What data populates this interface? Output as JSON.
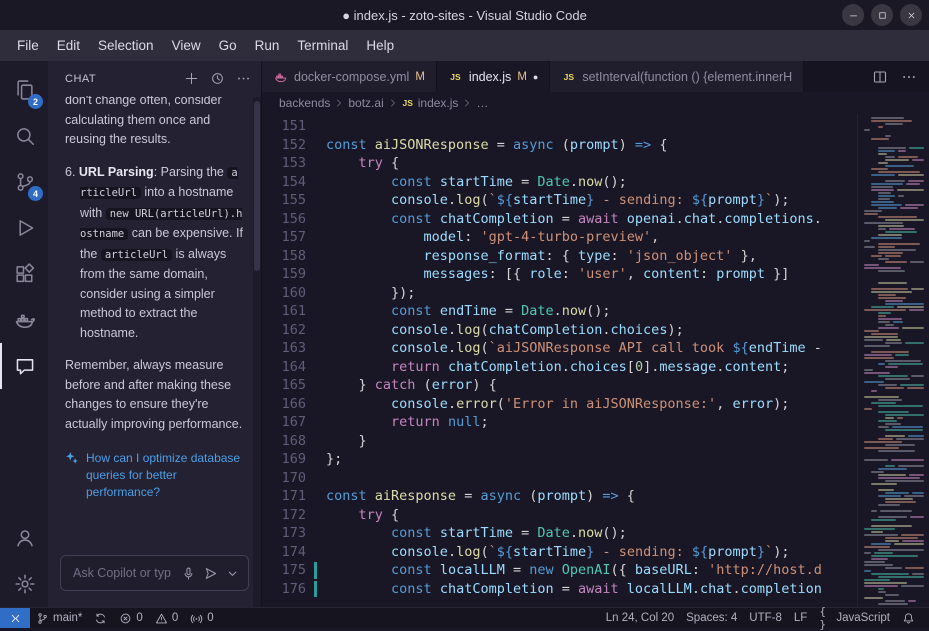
{
  "colors": {
    "accent_blue": "#2f6dc6",
    "modified_badge": "#e2c08d",
    "suggestion_blue": "#4d9fe6"
  },
  "titlebar": {
    "title": "● index.js - zoto-sites - Visual Studio Code",
    "controls": [
      "minimize",
      "maximize",
      "close"
    ]
  },
  "menubar": {
    "items": [
      "File",
      "Edit",
      "Selection",
      "View",
      "Go",
      "Run",
      "Terminal",
      "Help"
    ]
  },
  "activity_bar": {
    "top": [
      {
        "name": "explorer",
        "badge": "2"
      },
      {
        "name": "search"
      },
      {
        "name": "source-control",
        "badge": "4"
      },
      {
        "name": "run-debug"
      },
      {
        "name": "extensions"
      },
      {
        "name": "docker"
      },
      {
        "name": "chat",
        "active": true
      }
    ],
    "bottom": [
      {
        "name": "accounts"
      },
      {
        "name": "settings"
      }
    ]
  },
  "chat": {
    "title": "CHAT",
    "toolbar": [
      {
        "name": "new-chat",
        "icon": "add"
      },
      {
        "name": "history",
        "icon": "history"
      },
      {
        "name": "more",
        "icon": "more"
      }
    ],
    "paragraphs": [
      {
        "clip": true,
        "segs": [
          {
            "t": "p",
            "s": "don't change often, consider calculating them once and reusing the results."
          }
        ]
      },
      {
        "numbered": true,
        "segs": [
          {
            "t": "p",
            "s": "6. "
          },
          {
            "t": "b",
            "s": "URL Parsing"
          },
          {
            "t": "p",
            "s": ": Parsing the "
          },
          {
            "t": "c",
            "s": "articleUrl"
          },
          {
            "t": "p",
            "s": " into a hostname with "
          },
          {
            "t": "c",
            "s": "new URL(articleUrl).hostname"
          },
          {
            "t": "p",
            "s": " can be expensive. If the "
          },
          {
            "t": "c",
            "s": "articleUrl"
          },
          {
            "t": "p",
            "s": " is always from the same domain, consider using a simpler method to extract the hostname."
          }
        ]
      },
      {
        "segs": [
          {
            "t": "p",
            "s": "Remember, always measure before and after making these changes to ensure they're actually improving performance."
          }
        ]
      }
    ],
    "suggestion": {
      "icon": "sparkle",
      "text": "How can I optimize database queries for better performance?"
    },
    "input": {
      "placeholder": "Ask Copilot or typ",
      "icons": [
        {
          "name": "mic",
          "icon": "mic"
        },
        {
          "name": "send",
          "icon": "send"
        },
        {
          "name": "send-options",
          "icon": "chevron-down"
        }
      ]
    }
  },
  "editor": {
    "tabs": [
      {
        "name": "tab-docker-compose",
        "icon": "docker-file",
        "label": "docker-compose.yml",
        "badge": "M"
      },
      {
        "name": "tab-index-js",
        "icon": "js-file",
        "label": "index.js",
        "badge": "M",
        "dirty": true,
        "active": true
      },
      {
        "name": "tab-setinterval",
        "icon": "js-file",
        "label": "setInterval(function () {element.innerH"
      }
    ],
    "tab_actions": [
      {
        "name": "split-editor",
        "icon": "split-editor"
      },
      {
        "name": "more-actions",
        "icon": "more"
      }
    ],
    "breadcrumbs": [
      {
        "label": "backends"
      },
      {
        "label": "botz.ai"
      },
      {
        "label": "index.js",
        "icon": "js-file"
      },
      {
        "label": "…"
      }
    ],
    "code": {
      "lines": [
        {
          "n": 151,
          "t": []
        },
        {
          "n": 152,
          "t": [
            [
              "k",
              "const "
            ],
            [
              "f",
              "aiJSONResponse"
            ],
            [
              "p",
              " = "
            ],
            [
              "k",
              "async"
            ],
            [
              "p",
              " ("
            ],
            [
              "v",
              "prompt"
            ],
            [
              "p",
              ") "
            ],
            [
              "k",
              "=>"
            ],
            [
              "p",
              " {"
            ]
          ]
        },
        {
          "n": 153,
          "t": [
            [
              "p",
              "    "
            ],
            [
              "c",
              "try"
            ],
            [
              "p",
              " {"
            ]
          ]
        },
        {
          "n": 154,
          "t": [
            [
              "p",
              "        "
            ],
            [
              "k",
              "const "
            ],
            [
              "v",
              "startTime"
            ],
            [
              "p",
              " = "
            ],
            [
              "ty",
              "Date"
            ],
            [
              "p",
              "."
            ],
            [
              "f",
              "now"
            ],
            [
              "p",
              "();"
            ]
          ]
        },
        {
          "n": 155,
          "t": [
            [
              "p",
              "        "
            ],
            [
              "v",
              "console"
            ],
            [
              "p",
              "."
            ],
            [
              "f",
              "log"
            ],
            [
              "p",
              "("
            ],
            [
              "s",
              "`"
            ],
            [
              "k",
              "${"
            ],
            [
              "v",
              "startTime"
            ],
            [
              "k",
              "}"
            ],
            [
              "s",
              " - sending: "
            ],
            [
              "k",
              "${"
            ],
            [
              "v",
              "prompt"
            ],
            [
              "k",
              "}"
            ],
            [
              "s",
              "`"
            ],
            [
              "p",
              ");"
            ]
          ]
        },
        {
          "n": 156,
          "t": [
            [
              "p",
              "        "
            ],
            [
              "k",
              "const "
            ],
            [
              "v",
              "chatCompletion"
            ],
            [
              "p",
              " = "
            ],
            [
              "c",
              "await"
            ],
            [
              "p",
              " "
            ],
            [
              "v",
              "openai"
            ],
            [
              "p",
              "."
            ],
            [
              "v",
              "chat"
            ],
            [
              "p",
              "."
            ],
            [
              "v",
              "completions"
            ],
            [
              "p",
              "."
            ]
          ]
        },
        {
          "n": 157,
          "t": [
            [
              "p",
              "            "
            ],
            [
              "v",
              "model"
            ],
            [
              "p",
              ": "
            ],
            [
              "s",
              "'gpt-4-turbo-preview'"
            ],
            [
              "p",
              ","
            ]
          ]
        },
        {
          "n": 158,
          "t": [
            [
              "p",
              "            "
            ],
            [
              "v",
              "response_format"
            ],
            [
              "p",
              ": { "
            ],
            [
              "v",
              "type"
            ],
            [
              "p",
              ": "
            ],
            [
              "s",
              "'json_object'"
            ],
            [
              "p",
              " },"
            ]
          ]
        },
        {
          "n": 159,
          "t": [
            [
              "p",
              "            "
            ],
            [
              "v",
              "messages"
            ],
            [
              "p",
              ": [{ "
            ],
            [
              "v",
              "role"
            ],
            [
              "p",
              ": "
            ],
            [
              "s",
              "'user'"
            ],
            [
              "p",
              ", "
            ],
            [
              "v",
              "content"
            ],
            [
              "p",
              ": "
            ],
            [
              "v",
              "prompt"
            ],
            [
              "p",
              " }]"
            ]
          ]
        },
        {
          "n": 160,
          "t": [
            [
              "p",
              "        });"
            ]
          ]
        },
        {
          "n": 161,
          "t": [
            [
              "p",
              "        "
            ],
            [
              "k",
              "const "
            ],
            [
              "v",
              "endTime"
            ],
            [
              "p",
              " = "
            ],
            [
              "ty",
              "Date"
            ],
            [
              "p",
              "."
            ],
            [
              "f",
              "now"
            ],
            [
              "p",
              "();"
            ]
          ]
        },
        {
          "n": 162,
          "t": [
            [
              "p",
              "        "
            ],
            [
              "v",
              "console"
            ],
            [
              "p",
              "."
            ],
            [
              "f",
              "log"
            ],
            [
              "p",
              "("
            ],
            [
              "v",
              "chatCompletion"
            ],
            [
              "p",
              "."
            ],
            [
              "v",
              "choices"
            ],
            [
              "p",
              ");"
            ]
          ]
        },
        {
          "n": 163,
          "t": [
            [
              "p",
              "        "
            ],
            [
              "v",
              "console"
            ],
            [
              "p",
              "."
            ],
            [
              "f",
              "log"
            ],
            [
              "p",
              "("
            ],
            [
              "s",
              "`aiJSONResponse API call took "
            ],
            [
              "k",
              "${"
            ],
            [
              "v",
              "endTime"
            ],
            [
              "p",
              " -"
            ]
          ]
        },
        {
          "n": 164,
          "t": [
            [
              "p",
              "        "
            ],
            [
              "c",
              "return"
            ],
            [
              "p",
              " "
            ],
            [
              "v",
              "chatCompletion"
            ],
            [
              "p",
              "."
            ],
            [
              "v",
              "choices"
            ],
            [
              "p",
              "["
            ],
            [
              "num",
              "0"
            ],
            [
              "p",
              "]."
            ],
            [
              "v",
              "message"
            ],
            [
              "p",
              "."
            ],
            [
              "v",
              "content"
            ],
            [
              "p",
              ";"
            ]
          ]
        },
        {
          "n": 165,
          "t": [
            [
              "p",
              "    } "
            ],
            [
              "c",
              "catch"
            ],
            [
              "p",
              " ("
            ],
            [
              "v",
              "error"
            ],
            [
              "p",
              ") {"
            ]
          ]
        },
        {
          "n": 166,
          "t": [
            [
              "p",
              "        "
            ],
            [
              "v",
              "console"
            ],
            [
              "p",
              "."
            ],
            [
              "f",
              "error"
            ],
            [
              "p",
              "("
            ],
            [
              "s",
              "'Error in aiJSONResponse:'"
            ],
            [
              "p",
              ", "
            ],
            [
              "v",
              "error"
            ],
            [
              "p",
              ");"
            ]
          ]
        },
        {
          "n": 167,
          "t": [
            [
              "p",
              "        "
            ],
            [
              "c",
              "return"
            ],
            [
              "p",
              " "
            ],
            [
              "k",
              "null"
            ],
            [
              "p",
              ";"
            ]
          ]
        },
        {
          "n": 168,
          "t": [
            [
              "p",
              "    }"
            ]
          ]
        },
        {
          "n": 169,
          "t": [
            [
              "p",
              "};"
            ]
          ]
        },
        {
          "n": 170,
          "t": []
        },
        {
          "n": 171,
          "t": [
            [
              "k",
              "const "
            ],
            [
              "f",
              "aiResponse"
            ],
            [
              "p",
              " = "
            ],
            [
              "k",
              "async"
            ],
            [
              "p",
              " ("
            ],
            [
              "v",
              "prompt"
            ],
            [
              "p",
              ") "
            ],
            [
              "k",
              "=>"
            ],
            [
              "p",
              " {"
            ]
          ]
        },
        {
          "n": 172,
          "t": [
            [
              "p",
              "    "
            ],
            [
              "c",
              "try"
            ],
            [
              "p",
              " {"
            ]
          ]
        },
        {
          "n": 173,
          "t": [
            [
              "p",
              "        "
            ],
            [
              "k",
              "const "
            ],
            [
              "v",
              "startTime"
            ],
            [
              "p",
              " = "
            ],
            [
              "ty",
              "Date"
            ],
            [
              "p",
              "."
            ],
            [
              "f",
              "now"
            ],
            [
              "p",
              "();"
            ]
          ]
        },
        {
          "n": 174,
          "t": [
            [
              "p",
              "        "
            ],
            [
              "v",
              "console"
            ],
            [
              "p",
              "."
            ],
            [
              "f",
              "log"
            ],
            [
              "p",
              "("
            ],
            [
              "s",
              "`"
            ],
            [
              "k",
              "${"
            ],
            [
              "v",
              "startTime"
            ],
            [
              "k",
              "}"
            ],
            [
              "s",
              " - sending: "
            ],
            [
              "k",
              "${"
            ],
            [
              "v",
              "prompt"
            ],
            [
              "k",
              "}"
            ],
            [
              "s",
              "`"
            ],
            [
              "p",
              ");"
            ]
          ]
        },
        {
          "n": 175,
          "m": true,
          "t": [
            [
              "p",
              "        "
            ],
            [
              "k",
              "const "
            ],
            [
              "v",
              "localLLM"
            ],
            [
              "p",
              " = "
            ],
            [
              "k",
              "new "
            ],
            [
              "ty",
              "OpenAI"
            ],
            [
              "p",
              "({ "
            ],
            [
              "v",
              "baseURL"
            ],
            [
              "p",
              ": "
            ],
            [
              "s",
              "'http://host.d"
            ]
          ]
        },
        {
          "n": 176,
          "m": true,
          "t": [
            [
              "p",
              "        "
            ],
            [
              "k",
              "const "
            ],
            [
              "v",
              "chatCompletion"
            ],
            [
              "p",
              " = "
            ],
            [
              "c",
              "await"
            ],
            [
              "p",
              " "
            ],
            [
              "v",
              "localLLM"
            ],
            [
              "p",
              "."
            ],
            [
              "v",
              "chat"
            ],
            [
              "p",
              "."
            ],
            [
              "v",
              "completion"
            ]
          ]
        }
      ]
    }
  },
  "status_bar": {
    "remote": {
      "name": "remote",
      "icon": "remote"
    },
    "left": [
      {
        "name": "branch",
        "icon": "branch",
        "label": "main*"
      },
      {
        "name": "sync",
        "icon": "sync"
      },
      {
        "name": "errors",
        "icon": "error",
        "label": "0"
      },
      {
        "name": "warnings",
        "icon": "warning",
        "label": "0"
      },
      {
        "name": "ports",
        "icon": "broadcast",
        "label": "0"
      }
    ],
    "right": [
      {
        "name": "cursor-position",
        "label": "Ln 24, Col 20"
      },
      {
        "name": "indentation",
        "label": "Spaces: 4"
      },
      {
        "name": "encoding",
        "label": "UTF-8"
      },
      {
        "name": "eol",
        "label": "LF"
      },
      {
        "name": "language",
        "icon": "braces",
        "label": "JavaScript"
      },
      {
        "name": "notifications",
        "icon": "bell"
      }
    ]
  }
}
